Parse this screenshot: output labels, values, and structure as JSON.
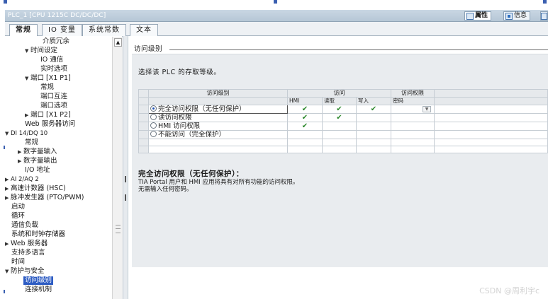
{
  "window": {
    "title": "PLC_1 [CPU 1215C DC/DC/DC]",
    "right_tabs": [
      "属性",
      "信息"
    ]
  },
  "tabs": [
    "常规",
    "IO 变量",
    "系统常数",
    "文本"
  ],
  "tree": [
    "介质冗余",
    "时间设定",
    "IO 通信",
    "实时选项",
    "端口 [X1 P1]",
    "常规",
    "端口互连",
    "端口选项",
    "端口 [X1 P2]",
    "Web 服务器访问",
    "DI 14/DQ 10",
    "常规",
    "数字量输入",
    "数字量输出",
    "I/O 地址",
    "AI 2/AQ 2",
    "高速计数器 (HSC)",
    "脉冲发生器 (PTO/PWM)",
    "启动",
    "循环",
    "通信负载",
    "系统和时钟存储器",
    "Web 服务器",
    "支持多语言",
    "时间",
    "防护与安全",
    "访问级别",
    "连接机制"
  ],
  "main": {
    "section_title": "访问级别",
    "description": "选择该 PLC 的存取等级。",
    "table": {
      "headers": {
        "level": "访问级别",
        "access": "访问",
        "permission": "访问权限",
        "hmi": "HMI",
        "read": "读取",
        "write": "写入",
        "password": "密码"
      },
      "rows": [
        {
          "label": "完全访问权限（无任何保护）",
          "hmi": "✔",
          "read": "✔",
          "write": "✔"
        },
        {
          "label": "读访问权限",
          "hmi": "✔",
          "read": "✔",
          "write": ""
        },
        {
          "label": "HMI 访问权限",
          "hmi": "✔",
          "read": "",
          "write": ""
        },
        {
          "label": "不能访问（完全保护）",
          "hmi": "",
          "read": "",
          "write": ""
        }
      ]
    },
    "summary": {
      "heading": "完全访问权限（无任何保护）：",
      "line1": "TIA Portal 用户和 HMI 应用将具有对所有功能的访问权限。",
      "line2": "无需输入任何密码。"
    }
  },
  "watermark": "CSDN @周利宇c",
  "colors": {
    "selection": "#2d5cc3",
    "check": "#2f8a2f",
    "titlebar": "#c9d7e3"
  }
}
